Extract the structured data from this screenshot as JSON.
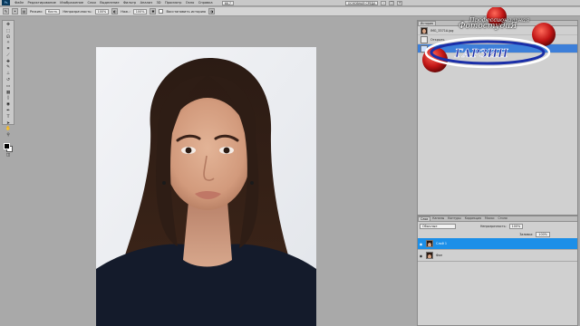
{
  "menubar": {
    "app_badge": "Ps",
    "items": [
      "Файл",
      "Редактирование",
      "Изображение",
      "Слои",
      "Выделение",
      "Фильтр",
      "Анализ",
      "3D",
      "Просмотр",
      "Окно",
      "Справка"
    ],
    "zoom": "66,7",
    "workspace": "ОСНОВНАЯ СРЕДА"
  },
  "options": {
    "mode_label": "Режим:",
    "mode_value": "Кисть",
    "opacity_label": "Непрозрачность:",
    "opacity_value": "100%",
    "flow_label": "Наж.:",
    "flow_value": "100%",
    "erase_history_label": "Восстановить историю"
  },
  "history": {
    "tabs": [
      "История"
    ],
    "rows": [
      {
        "label": "IMG_3371A.jpg"
      },
      {
        "label": "Открыть"
      },
      {
        "label": ""
      }
    ]
  },
  "layers": {
    "tabs": [
      "Слои",
      "Каналы",
      "Контуры",
      "Коррекция",
      "Маски",
      "Стили"
    ],
    "blend_mode": "Обычные",
    "opacity_label": "Непрозрачность:",
    "opacity_value": "100%",
    "fill_label": "Заливка:",
    "fill_value": "100%",
    "rows": [
      {
        "label": "Слой 1"
      },
      {
        "label": "Фон"
      }
    ]
  },
  "watermark": {
    "line1": "Профессиональная",
    "line2": "ФотостудиЯ",
    "brand": "ГАРЗИН"
  },
  "colors": {
    "selection": "#1c8fe8",
    "logo_ring": "#c01515",
    "logo_blue": "#1a2ea8"
  }
}
